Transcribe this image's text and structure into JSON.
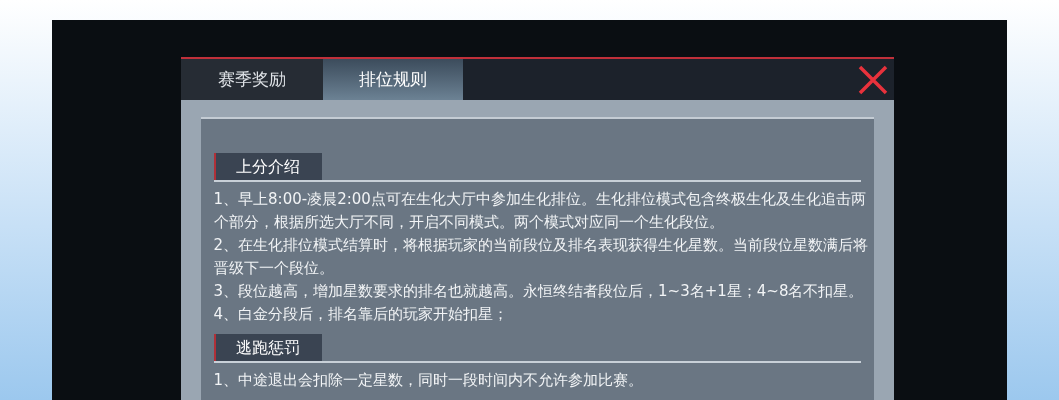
{
  "tabs": [
    {
      "label": "赛季奖励",
      "selected": false
    },
    {
      "label": "排位规则",
      "selected": true
    }
  ],
  "sections": [
    {
      "title": "上分介绍",
      "items": [
        "1、早上8:00-凌晨2:00点可在生化大厅中参加生化排位。生化排位模式包含终极生化及生化追击两个部分，根据所选大厅不同，开启不同模式。两个模式对应同一个生化段位。",
        "2、在生化排位模式结算时，将根据玩家的当前段位及排名表现获得生化星数。当前段位星数满后将晋级下一个段位。",
        "3、段位越高，增加星数要求的排名也就越高。永恒终结者段位后，1~3名+1星；4~8名不扣星。",
        "4、白金分段后，排名靠后的玩家开始扣星；"
      ]
    },
    {
      "title": "逃跑惩罚",
      "items": [
        "1、中途退出会扣除一定星数，同时一段时间内不允许参加比赛。"
      ]
    }
  ]
}
